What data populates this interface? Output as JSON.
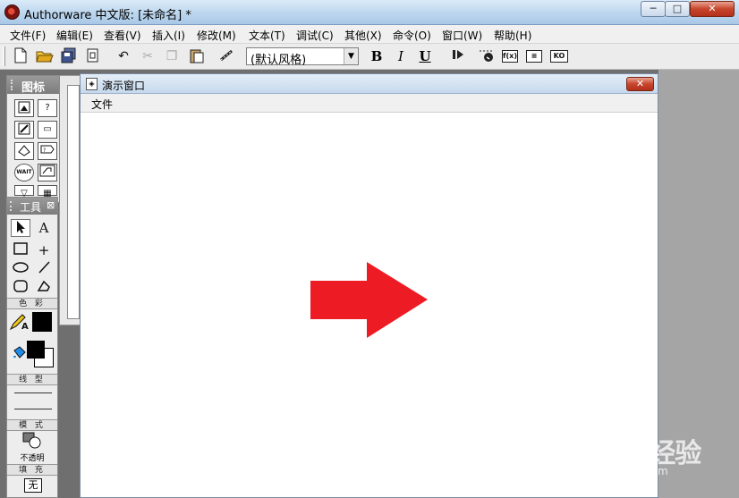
{
  "window": {
    "title": "Authorware 中文版: [未命名] *",
    "min_glyph": "─",
    "max_glyph": "□",
    "close_glyph": "✕"
  },
  "menu": {
    "file": "文件(F)",
    "edit": "编辑(E)",
    "view": "查看(V)",
    "insert": "插入(I)",
    "modify": "修改(M)",
    "text": "文本(T)",
    "debug": "调试(C)",
    "other": "其他(X)",
    "command": "命令(O)",
    "window": "窗口(W)",
    "help": "帮助(H)"
  },
  "toolbar": {
    "style_value": "(默认风格)",
    "bold": "B",
    "italic": "I",
    "underline": "U",
    "icons": [
      "new-file-icon",
      "open-folder-icon",
      "save-all-icon",
      "import-icon",
      "undo-icon",
      "cut-icon",
      "copy-icon",
      "paste-icon",
      "find-icon",
      "run-icon",
      "control-panel-icon",
      "functions-icon",
      "variables-icon",
      "knowledge-objects-icon"
    ]
  },
  "icon_palette": {
    "title": "图标",
    "icons": [
      "display-icon",
      "motion-icon",
      "erase-icon",
      "wait-icon",
      "navigate-icon",
      "framework-icon",
      "decision-icon",
      "interaction-icon",
      "calculation-icon",
      "map-icon",
      "digital-movie-icon",
      "sound-icon",
      "video-icon",
      "knowledge-object-icon"
    ],
    "wait_label": "WAIT"
  },
  "tools_palette": {
    "title": "工具",
    "color_label": "色 彩",
    "line_label": "线 型",
    "mode_label": "模 式",
    "mode_value": "不透明",
    "fill_label": "填 充",
    "fill_value": "无",
    "text_tool": "A",
    "fg_color": "#000000"
  },
  "presentation": {
    "title": "演示窗口",
    "menu_file": "文件",
    "arrow_color": "#ed1c24"
  },
  "watermark": {
    "logo": "Baidu经验",
    "url": "jingyan.baidu.com"
  }
}
